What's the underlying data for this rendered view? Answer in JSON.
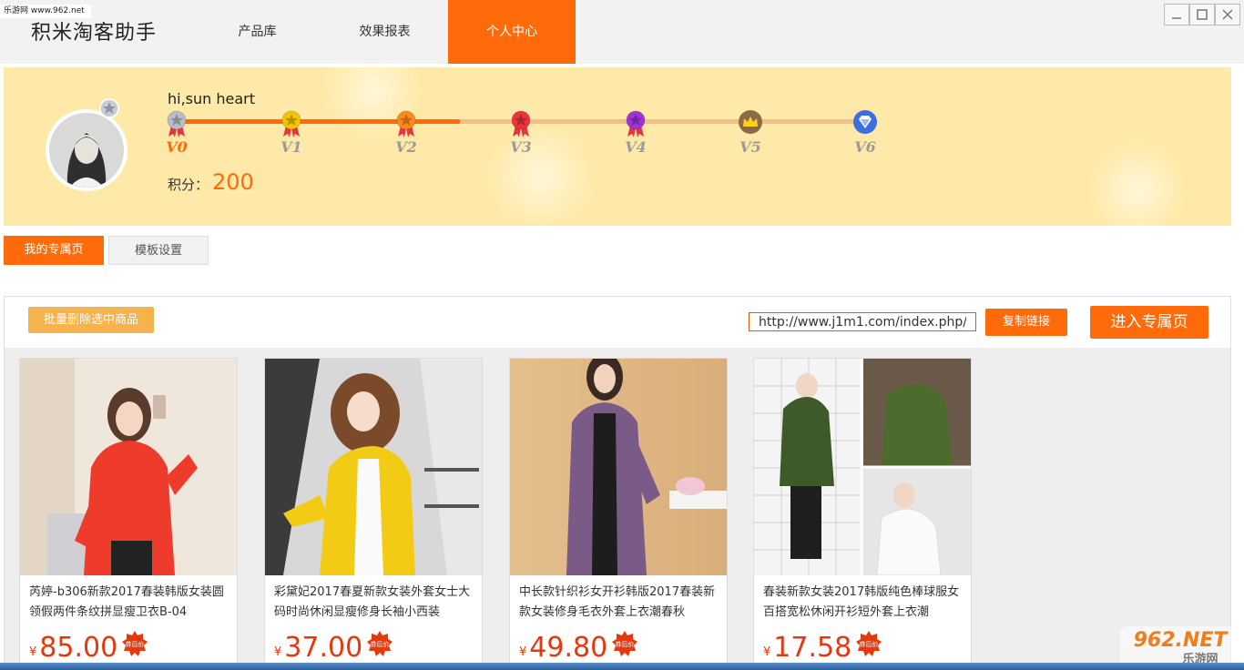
{
  "watermark_top": "乐游网 www.962.net",
  "app": {
    "title": "积米淘客助手"
  },
  "nav": {
    "products": "产品库",
    "reports": "效果报表",
    "personal": "个人中心"
  },
  "profile": {
    "greeting": "hi,sun heart",
    "points_label": "积分：",
    "points_value": "200",
    "current_level": 0,
    "progress_fraction": 0.41,
    "levels": [
      {
        "label": "V0",
        "icon": "silver-star-medal-icon",
        "color": "#b8bcc6"
      },
      {
        "label": "V1",
        "icon": "gold-star-medal-icon",
        "color": "#f5c400"
      },
      {
        "label": "V2",
        "icon": "orange-star-medal-icon",
        "color": "#ff8a1a"
      },
      {
        "label": "V3",
        "icon": "red-star-medal-icon",
        "color": "#e8343c"
      },
      {
        "label": "V4",
        "icon": "purple-star-medal-icon",
        "color": "#9b33d6"
      },
      {
        "label": "V5",
        "icon": "crown-icon",
        "color": "#8a6a48"
      },
      {
        "label": "V6",
        "icon": "diamond-icon",
        "color": "#3c6ee0"
      }
    ]
  },
  "tabs": {
    "mypage": "我的专属页",
    "template": "模板设置"
  },
  "toolbar": {
    "batch_delete": "批量删除选中商品",
    "url": "http://www.j1m1.com/index.php/",
    "copy_link": "复制链接",
    "enter_page": "进入专属页"
  },
  "products": [
    {
      "title": "芮婷-b306新款2017春装韩版女装圆领假两件条纹拼显瘦卫衣B-04",
      "currency": "¥",
      "price": "85.00",
      "badge": "券后价"
    },
    {
      "title": "彩黛妃2017春夏新款女装外套女士大码时尚休闲显瘦修身长袖小西装",
      "currency": "¥",
      "price": "37.00",
      "badge": "券后价"
    },
    {
      "title": "中长款针织衫女开衫韩版2017春装新款女装修身毛衣外套上衣潮春秋",
      "currency": "¥",
      "price": "49.80",
      "badge": "券后价"
    },
    {
      "title": "春装新款女装2017韩版纯色棒球服女百搭宽松休闲开衫短外套上衣潮",
      "currency": "¥",
      "price": "17.58",
      "badge": "券后价"
    }
  ],
  "watermark": {
    "brand": "962.NET",
    "sub": "乐游网"
  },
  "colors": {
    "accent": "#ff6a0a",
    "banner": "#ffe9a8",
    "price": "#e5380d",
    "batch_button": "#f5b24d"
  }
}
